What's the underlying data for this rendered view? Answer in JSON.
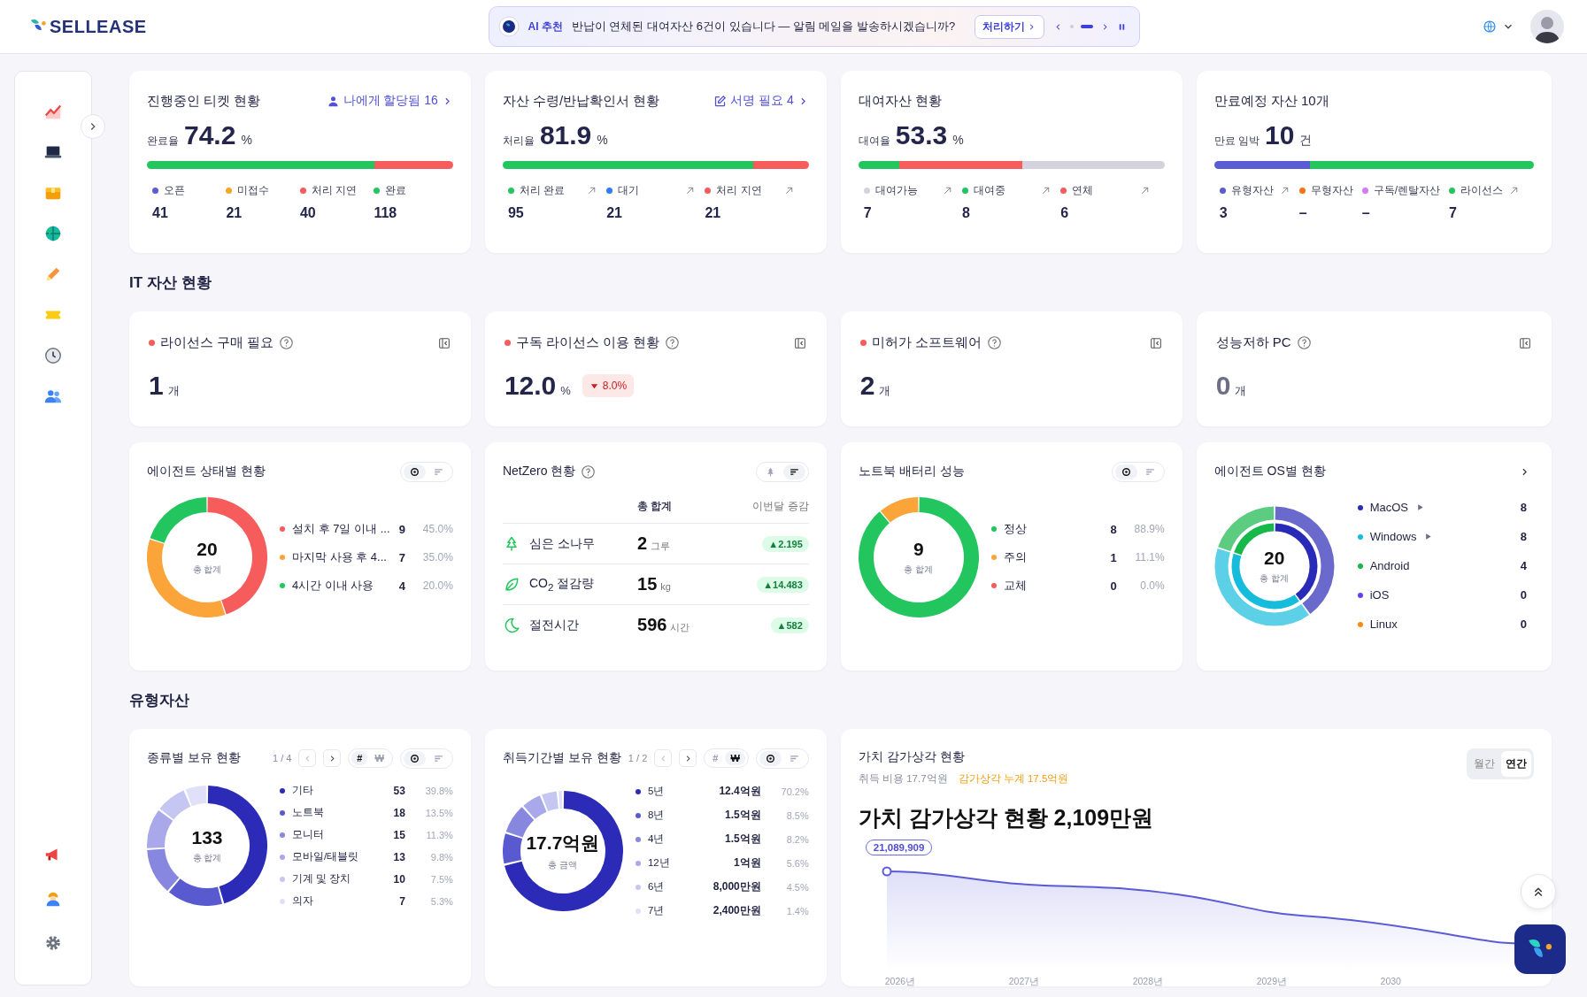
{
  "header": {
    "logo": "SELLEASE",
    "ai_badge": "AI 추천",
    "ai_message": "반납이 연체된 대여자산 6건이 있습니다 — 알림 메일을 발송하시겠습니까?",
    "ai_action": "처리하기",
    "pager": [
      {
        "selected": false
      },
      {
        "selected": true
      }
    ]
  },
  "sidebar": {
    "items": [
      {
        "kind": "chart"
      },
      {
        "kind": "laptop"
      },
      {
        "kind": "box"
      },
      {
        "kind": "globe"
      },
      {
        "kind": "pencil"
      },
      {
        "kind": "ticket"
      },
      {
        "kind": "clock"
      },
      {
        "kind": "users"
      }
    ],
    "bottom_items": [
      {
        "kind": "megaphone"
      },
      {
        "kind": "worker"
      },
      {
        "kind": "gear"
      }
    ]
  },
  "summary_cards": [
    {
      "title": "진행중인 티켓 현황",
      "link": {
        "kind": "user",
        "label": "나에게 할당됨 16"
      },
      "rate_label": "완료율",
      "rate": "74.2",
      "unit": "%",
      "bar": [
        {
          "color": "#22c55e"
        },
        {
          "color": "#f75c5c"
        }
      ],
      "stats": [
        {
          "label": "오픈",
          "value": "41",
          "color": "#5b5bd6",
          "linked": false
        },
        {
          "label": "미접수",
          "value": "21",
          "color": "#f5a623",
          "linked": false
        },
        {
          "label": "처리 지연",
          "value": "40",
          "color": "#f75c5c",
          "linked": false
        },
        {
          "label": "완료",
          "value": "118",
          "color": "#22c55e",
          "linked": false
        }
      ]
    },
    {
      "title": "자산 수령/반납확인서 현황",
      "link": {
        "kind": "edit",
        "label": "서명 필요 4"
      },
      "rate_label": "처리율",
      "rate": "81.9",
      "unit": "%",
      "bar": [
        {
          "color": "#22c55e"
        },
        {
          "color": "#f75c5c"
        }
      ],
      "stats": [
        {
          "label": "처리 완료",
          "value": "95",
          "color": "#22c55e",
          "linked": true
        },
        {
          "label": "대기",
          "value": "21",
          "color": "#2f7cf6",
          "linked": true
        },
        {
          "label": "처리 지연",
          "value": "21",
          "color": "#f75c5c",
          "linked": true
        }
      ]
    },
    {
      "title": "대여자산 현황",
      "rate_label": "대여율",
      "rate": "53.3",
      "unit": "%",
      "bar": [
        {
          "color": "#22c55e"
        },
        {
          "color": "#f75c5c"
        },
        {
          "color": "#d4d2dc"
        }
      ],
      "stats": [
        {
          "label": "대여가능",
          "value": "7",
          "color": "#d4d2dc",
          "linked": true
        },
        {
          "label": "대여중",
          "value": "8",
          "color": "#22c55e",
          "linked": true
        },
        {
          "label": "연체",
          "value": "6",
          "color": "#f75c5c",
          "linked": true
        }
      ]
    },
    {
      "title": "만료예정 자산 10개",
      "rate_label": "만료 임박",
      "rate": "10",
      "unit": "건",
      "bar": [
        {
          "color": "#5b5bd6"
        },
        {
          "color": "#22c55e"
        }
      ],
      "stats": [
        {
          "label": "유형자산",
          "value": "3",
          "color": "#5b5bd6",
          "linked": true
        },
        {
          "label": "무형자산",
          "value": "–",
          "color": "#f97316",
          "linked": false
        },
        {
          "label": "구독/렌탈자산",
          "value": "–",
          "color": "#d17cf5",
          "linked": false
        },
        {
          "label": "라이선스",
          "value": "7",
          "color": "#22c55e",
          "linked": true
        }
      ]
    }
  ],
  "it_assets": {
    "heading": "IT 자산 현황",
    "kpis": [
      {
        "title": "라이선스 구매 필요",
        "alert": true,
        "value": "1",
        "unit": "개",
        "muted": false
      },
      {
        "title": "구독 라이선스 이용 현황",
        "alert": true,
        "value": "12.0",
        "unit": "%",
        "muted": false,
        "decrease": true,
        "change": "8.0%"
      },
      {
        "title": "미허가 소프트웨어",
        "alert": true,
        "value": "2",
        "unit": "개",
        "muted": false
      },
      {
        "title": "성능저하 PC",
        "alert": false,
        "value": "0",
        "unit": "개",
        "muted": true
      }
    ],
    "agent_status": {
      "title": "에이전트 상태별 현황",
      "view_toggle": [
        {
          "kind": "donut",
          "selected": true
        },
        {
          "kind": "list",
          "selected": false
        }
      ],
      "total": "20",
      "total_label": "총 합계",
      "chart_data": {
        "type": "donut",
        "legend": "right",
        "categories": [
          "설치 후 7일 이내 ...",
          "마지막 사용 후 4...",
          "4시간 이내 사용"
        ],
        "values": [
          9,
          7,
          4
        ]
      },
      "rows": [
        {
          "count": "9",
          "share": "45.0%",
          "color": "#f75c5c"
        },
        {
          "count": "7",
          "share": "35.0%",
          "color": "#fba43a"
        },
        {
          "count": "4",
          "share": "20.0%",
          "color": "#22c55e"
        }
      ]
    },
    "netzero": {
      "title": "NetZero 현황",
      "view_toggle": [
        {
          "kind": "tree",
          "selected": false
        },
        {
          "kind": "list",
          "selected": true
        }
      ],
      "columns": [
        "총 합계",
        "이번달 증감"
      ],
      "rows": [
        {
          "kind": "tree",
          "label": "심은 소나무",
          "value": "2",
          "unit": "그루",
          "change": "▲2.195"
        },
        {
          "kind": "leaf",
          "label": "CO$_{2}$ 절감량",
          "value": "15",
          "unit": "kg",
          "change": "▲14.483"
        },
        {
          "kind": "moon",
          "label": "절전시간",
          "value": "596",
          "unit": "시간",
          "change": "▲582"
        }
      ]
    },
    "battery": {
      "title": "노트북 배터리 성능",
      "view_toggle": [
        {
          "kind": "donut",
          "selected": true
        },
        {
          "kind": "list",
          "selected": false
        }
      ],
      "total": "9",
      "total_label": "총 합계",
      "chart_data": {
        "type": "donut",
        "legend": "right",
        "categories": [
          "정상",
          "주의",
          "교체"
        ],
        "values": [
          88.9,
          11.1,
          0
        ]
      },
      "rows": [
        {
          "count": "8",
          "share": "88.9%",
          "color": "#22c55e"
        },
        {
          "count": "1",
          "share": "11.1%",
          "color": "#fba43a"
        },
        {
          "count": "0",
          "share": "0.0%",
          "color": "#f75c5c"
        }
      ]
    },
    "agent_os": {
      "title": "에이전트 OS별 현황",
      "open_link": true,
      "outer_ring": true,
      "total": "20",
      "total_label": "총 합계",
      "chart_data": {
        "type": "donut",
        "legend": "right",
        "categories": [
          "MacOS",
          "Windows",
          "Android",
          "iOS",
          "Linux"
        ],
        "series": [
          {
            "colors": [
              "#6a6acd",
              "#5cd0e6",
              "#5ccd80",
              "#9677f8",
              "#faaf58"
            ],
            "values": [
              40,
              40,
              20,
              0,
              0
            ]
          },
          {
            "colors": [
              "#2a2ab8",
              "#16bcdc",
              "#16b84a",
              "#6a3df5",
              "#f78c10"
            ],
            "values": [
              40,
              40,
              20,
              0,
              0
            ]
          }
        ]
      },
      "rows": [
        {
          "count": "8",
          "color": "#2a2ab8",
          "expandable": true
        },
        {
          "count": "8",
          "color": "#16bcdc",
          "expandable": true
        },
        {
          "count": "4",
          "color": "#16b84a",
          "expandable": false
        },
        {
          "count": "0",
          "color": "#6a3df5",
          "expandable": false
        },
        {
          "count": "0",
          "color": "#f78c10",
          "expandable": false
        }
      ]
    }
  },
  "tangible_assets": {
    "heading": "유형자산",
    "by_type": {
      "title": "종류별 보유 현황",
      "page": "1 / 4",
      "unit_toggle": [
        {
          "label": "#",
          "selected": true
        },
        {
          "label": "₩",
          "selected": false
        }
      ],
      "view_toggle": [
        {
          "kind": "donut",
          "selected": true
        },
        {
          "kind": "list",
          "selected": false
        }
      ],
      "total": "133",
      "total_label": "총 합계",
      "chart_data": {
        "type": "donut",
        "legend": "right",
        "categories": [
          "기타",
          "노트북",
          "모니터",
          "모바일/태블릿",
          "기계 및 장치",
          "의자"
        ],
        "values": [
          45.7,
          15.5,
          12.9,
          11.2,
          8.6,
          6.1
        ]
      },
      "rows": [
        {
          "count": "53",
          "share": "39.8%",
          "color": "#2b2bb8"
        },
        {
          "count": "18",
          "share": "13.5%",
          "color": "#5a5ad0"
        },
        {
          "count": "15",
          "share": "11.3%",
          "color": "#8787e0"
        },
        {
          "count": "13",
          "share": "9.8%",
          "color": "#a8a8ea"
        },
        {
          "count": "10",
          "share": "7.5%",
          "color": "#c6c6f2"
        },
        {
          "count": "7",
          "share": "5.3%",
          "color": "#e0e0f8"
        }
      ]
    },
    "by_period": {
      "title": "취득기간별 보유 현황",
      "page": "1 / 2",
      "unit_toggle": [
        {
          "label": "#",
          "selected": false
        },
        {
          "label": "₩",
          "selected": true
        }
      ],
      "view_toggle": [
        {
          "kind": "donut",
          "selected": true
        },
        {
          "kind": "list",
          "selected": false
        }
      ],
      "total": "17.7억원",
      "total_label": "총 금액",
      "chart_data": {
        "type": "donut",
        "legend": "right",
        "categories": [
          "5년",
          "8년",
          "4년",
          "12년",
          "6년",
          "7년"
        ],
        "values": [
          70.2,
          8.5,
          8.2,
          5.6,
          4.5,
          1.4
        ]
      },
      "rows": [
        {
          "count": "12.4억원",
          "share": "70.2%",
          "color": "#2b2bb8"
        },
        {
          "count": "1.5억원",
          "share": "8.5%",
          "color": "#5a5ad0"
        },
        {
          "count": "1.5억원",
          "share": "8.2%",
          "color": "#8787e0"
        },
        {
          "count": "1억원",
          "share": "5.6%",
          "color": "#a8a8ea"
        },
        {
          "count": "8,000만원",
          "share": "4.5%",
          "color": "#c6c6f2"
        },
        {
          "count": "2,400만원",
          "share": "1.4%",
          "color": "#e0e0f8"
        }
      ]
    },
    "depreciation": {
      "title": "가치 감가상각 현황",
      "cost": "취득 비용 17.7억원",
      "accumulated": "감가상각 누계 17.5억원",
      "periods": [
        {
          "label": "월간",
          "selected": false
        },
        {
          "label": "연간",
          "selected": true
        }
      ],
      "headline": "가치 감가상각 현황 2,109만원",
      "point_label": "21,089,909",
      "x_labels": [
        "2026년",
        "2027년",
        "2028년",
        "2029년",
        "2030"
      ]
    }
  }
}
